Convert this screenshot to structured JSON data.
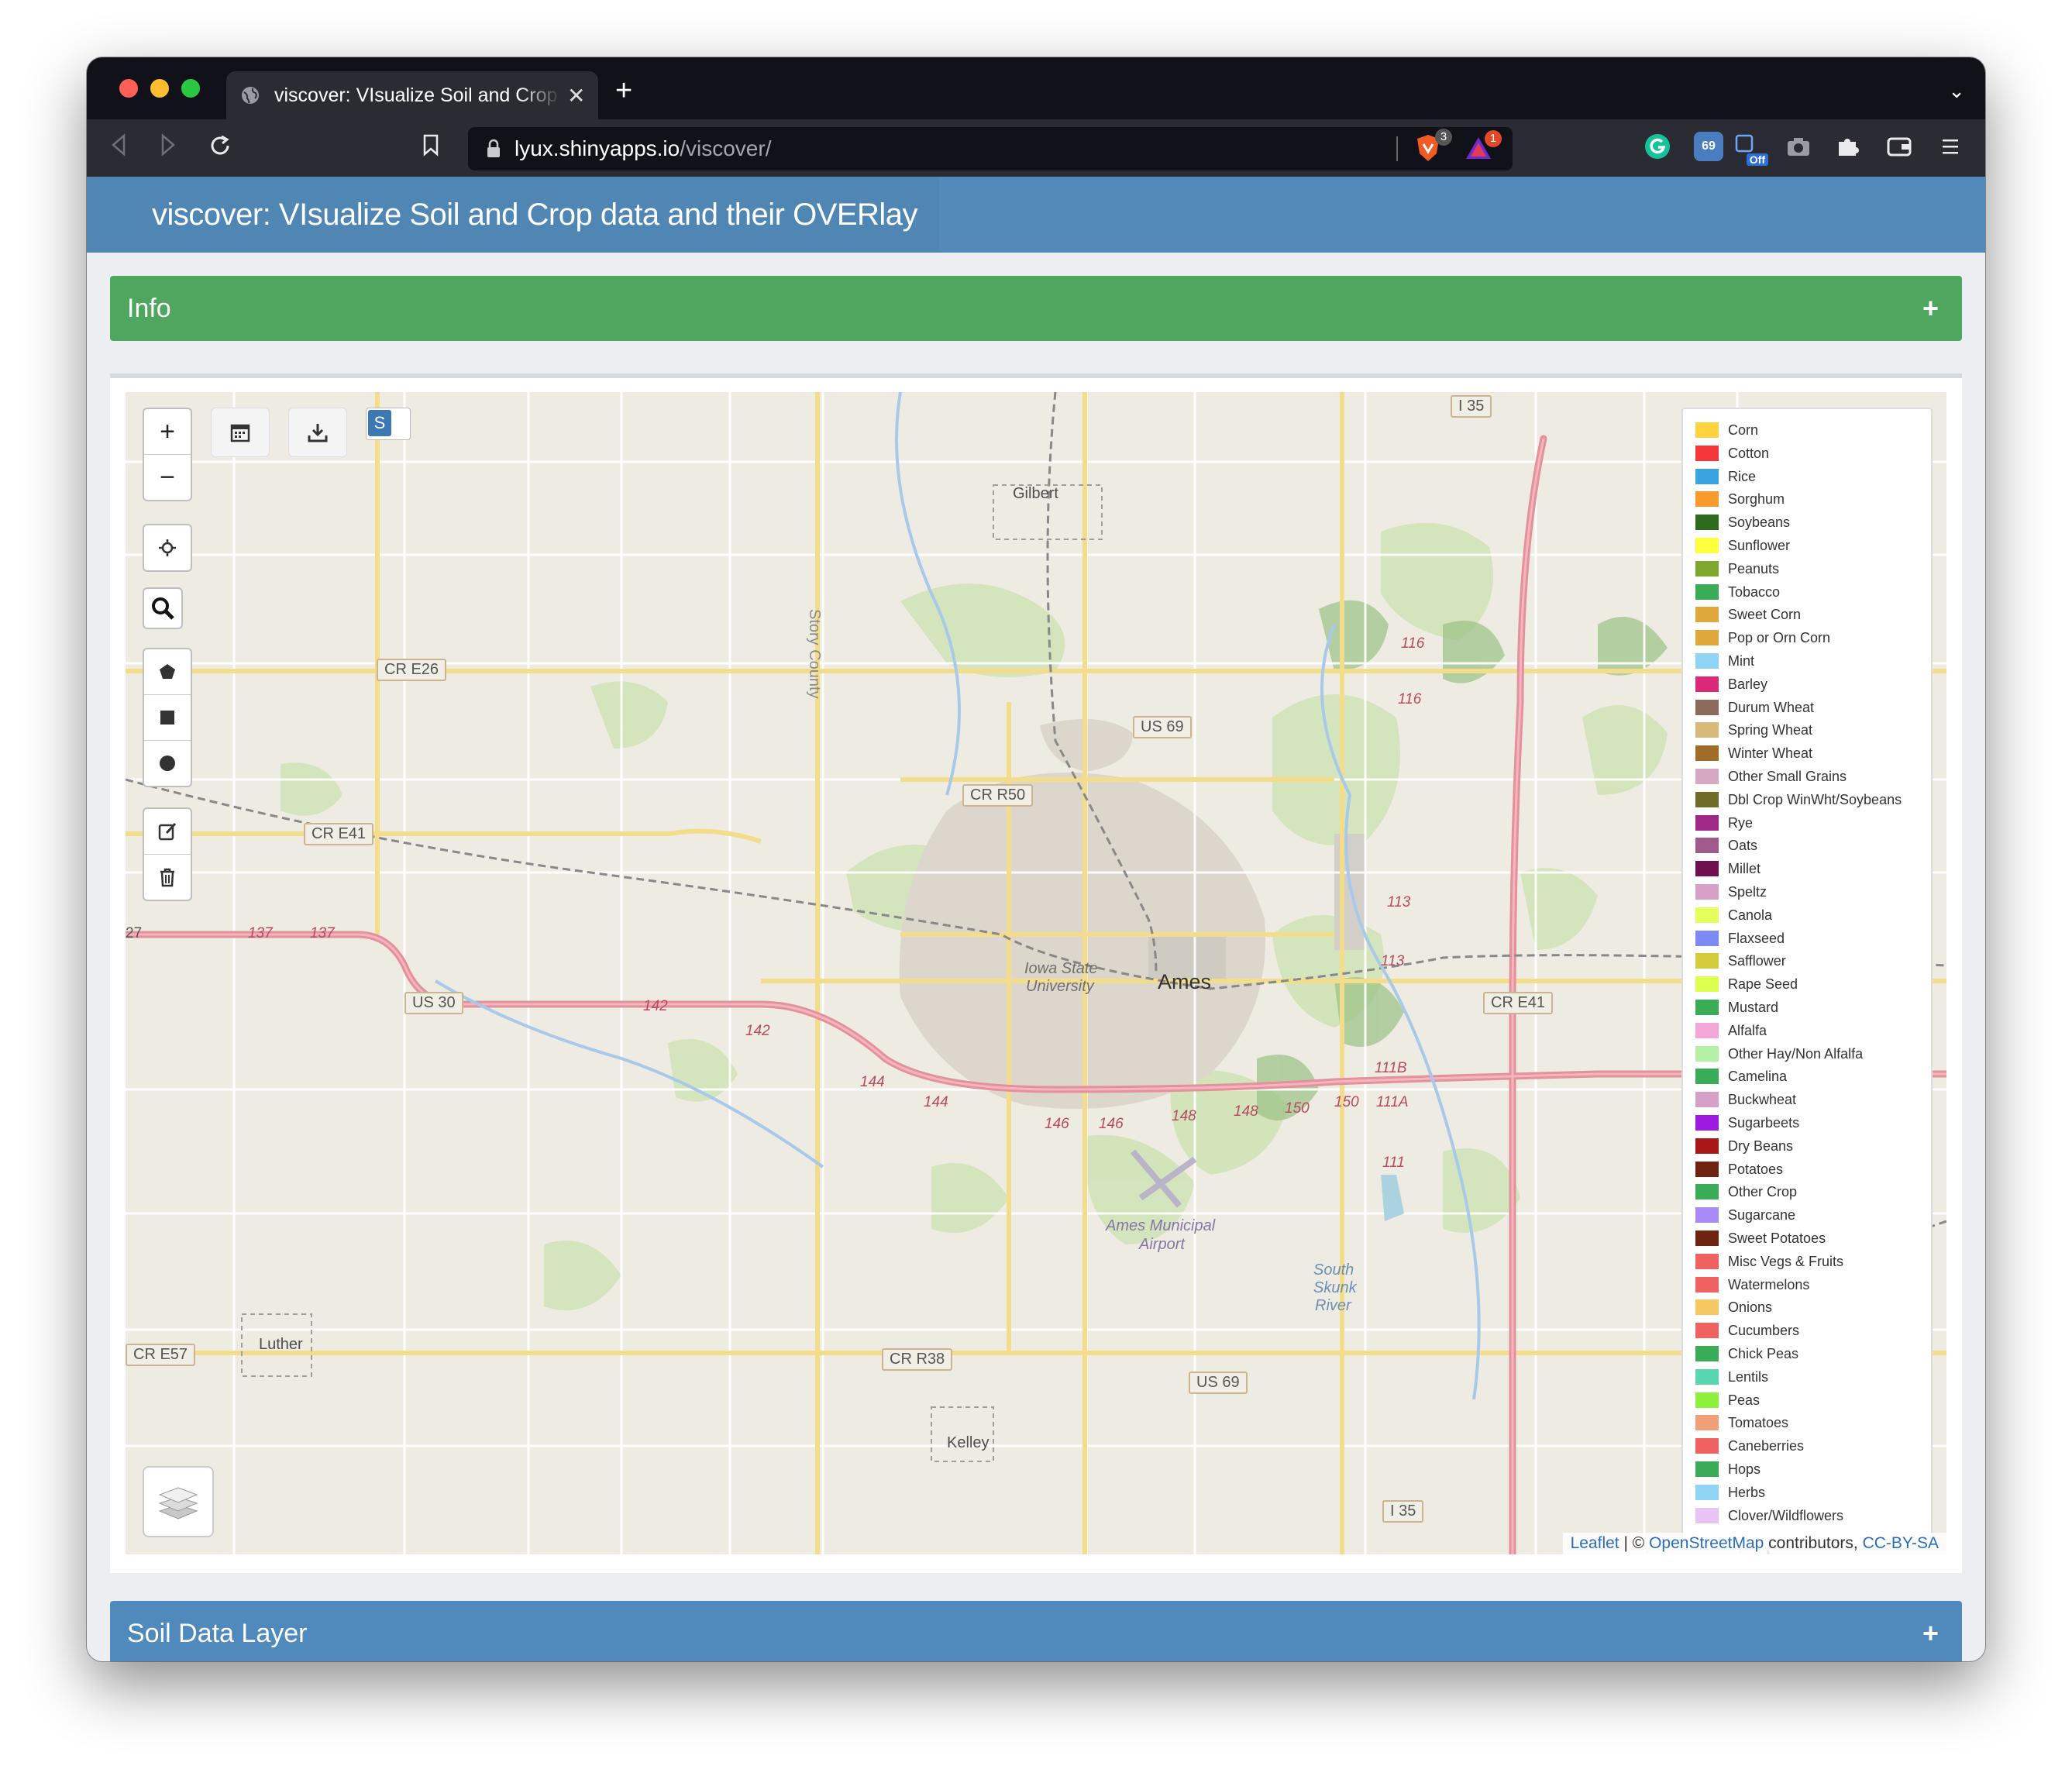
{
  "browser": {
    "tab_title": "viscover: VIsualize Soil and Crop data and their OVERlay",
    "tab_close": "✕",
    "new_tab": "+",
    "url_host": "lyux.shinyapps.io",
    "url_path": "/viscover/",
    "brave_badge": "3",
    "rewards_badge": "1",
    "ext_counter": "69",
    "ext_off_label": "Off"
  },
  "navbar": {
    "title": "viscover: VIsualize Soil and Crop data and their OVERlay"
  },
  "panels": {
    "info": {
      "title": "Info",
      "toggle": "+",
      "color": "#4ea65f"
    },
    "soil": {
      "title": "Soil Data Layer",
      "toggle": "+",
      "color": "#5089bb"
    }
  },
  "map": {
    "zoom_in": "+",
    "zoom_out": "−",
    "search_toggle": "S",
    "places": [
      {
        "name": "Gilbert"
      },
      {
        "name": "Ames"
      },
      {
        "name": "Iowa State"
      },
      {
        "name": "University"
      },
      {
        "name": "Story County"
      },
      {
        "name": "Luther"
      },
      {
        "name": "Kelley"
      },
      {
        "name": "Ames Municipal"
      },
      {
        "name": "Airport"
      },
      {
        "name": "South"
      },
      {
        "name": "Skunk"
      },
      {
        "name": "River"
      }
    ],
    "shields": [
      "CR E26",
      "CR E41",
      "CR R50",
      "US 69",
      "US 30",
      "CR E41",
      "CR R38",
      "US 69",
      "CR E57",
      "I 35",
      "I 35"
    ],
    "highway_numbers": [
      "137",
      "137",
      "142",
      "142",
      "144",
      "144",
      "146",
      "146",
      "148",
      "148",
      "150",
      "150",
      "111A",
      "111B",
      "111",
      "113",
      "113",
      "116",
      "116",
      "27"
    ],
    "attribution": {
      "leaflet": "Leaflet",
      "sep": " | © ",
      "osm": "OpenStreetMap",
      "contrib": " contributors, ",
      "license": "CC-BY-SA"
    }
  },
  "legend": [
    {
      "label": "Corn",
      "color": "#ffd33e"
    },
    {
      "label": "Cotton",
      "color": "#f5373a"
    },
    {
      "label": "Rice",
      "color": "#3aa4e0"
    },
    {
      "label": "Sorghum",
      "color": "#f99a2c"
    },
    {
      "label": "Soybeans",
      "color": "#2e6b1f"
    },
    {
      "label": "Sunflower",
      "color": "#ffff3e"
    },
    {
      "label": "Peanuts",
      "color": "#7ea72e"
    },
    {
      "label": "Tobacco",
      "color": "#3aac58"
    },
    {
      "label": "Sweet Corn",
      "color": "#e0a83a"
    },
    {
      "label": "Pop or Orn Corn",
      "color": "#e0a83a"
    },
    {
      "label": "Mint",
      "color": "#8fd3f5"
    },
    {
      "label": "Barley",
      "color": "#dc2878"
    },
    {
      "label": "Durum Wheat",
      "color": "#8c6a5c"
    },
    {
      "label": "Spring Wheat",
      "color": "#d9b97a"
    },
    {
      "label": "Winter Wheat",
      "color": "#a06d28"
    },
    {
      "label": "Other Small Grains",
      "color": "#d7a8c2"
    },
    {
      "label": "Dbl Crop WinWht/Soybeans",
      "color": "#6f6b28"
    },
    {
      "label": "Rye",
      "color": "#a02887"
    },
    {
      "label": "Oats",
      "color": "#a05a8c"
    },
    {
      "label": "Millet",
      "color": "#6e1050"
    },
    {
      "label": "Speltz",
      "color": "#d6a0c8"
    },
    {
      "label": "Canola",
      "color": "#e3ff5a"
    },
    {
      "label": "Flaxseed",
      "color": "#7b8af5"
    },
    {
      "label": "Safflower",
      "color": "#d4cc3c"
    },
    {
      "label": "Rape Seed",
      "color": "#dcff50"
    },
    {
      "label": "Mustard",
      "color": "#3aac58"
    },
    {
      "label": "Alfalfa",
      "color": "#f3a6d8"
    },
    {
      "label": "Other Hay/Non Alfalfa",
      "color": "#b2f0a8"
    },
    {
      "label": "Camelina",
      "color": "#3aac58"
    },
    {
      "label": "Buckwheat",
      "color": "#d6a0c8"
    },
    {
      "label": "Sugarbeets",
      "color": "#9e1ae0"
    },
    {
      "label": "Dry Beans",
      "color": "#a81818"
    },
    {
      "label": "Potatoes",
      "color": "#6e2410"
    },
    {
      "label": "Other Crop",
      "color": "#3aac58"
    },
    {
      "label": "Sugarcane",
      "color": "#a88af5"
    },
    {
      "label": "Sweet Potatoes",
      "color": "#6e2410"
    },
    {
      "label": "Misc Vegs & Fruits",
      "color": "#f06262"
    },
    {
      "label": "Watermelons",
      "color": "#f06262"
    },
    {
      "label": "Onions",
      "color": "#f5c860"
    },
    {
      "label": "Cucumbers",
      "color": "#f06262"
    },
    {
      "label": "Chick Peas",
      "color": "#3aac58"
    },
    {
      "label": "Lentils",
      "color": "#58d6b0"
    },
    {
      "label": "Peas",
      "color": "#8cf03c"
    },
    {
      "label": "Tomatoes",
      "color": "#f0a078"
    },
    {
      "label": "Caneberries",
      "color": "#f06262"
    },
    {
      "label": "Hops",
      "color": "#3aac58"
    },
    {
      "label": "Herbs",
      "color": "#8fd3f5"
    },
    {
      "label": "Clover/Wildflowers",
      "color": "#e8c4f5"
    }
  ]
}
